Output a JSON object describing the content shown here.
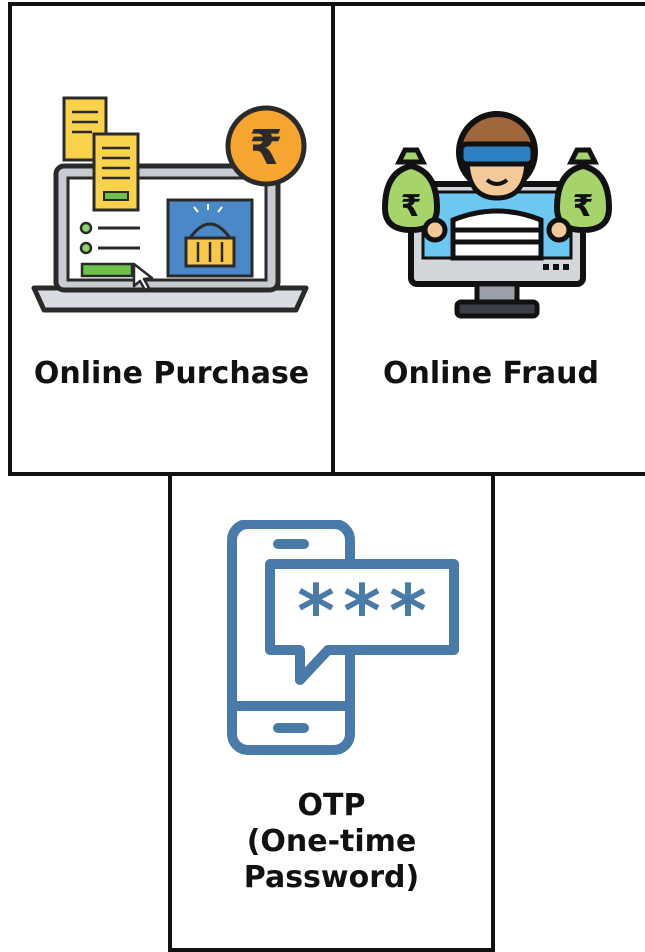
{
  "cards": [
    {
      "label": "Online Purchase",
      "icon": "laptop-shopping-rupee-icon"
    },
    {
      "label": "Online Fraud",
      "icon": "thief-money-bags-monitor-icon"
    },
    {
      "label_lines": [
        "OTP",
        "(One-time",
        "Password)"
      ],
      "icon": "phone-otp-password-icon"
    }
  ],
  "colors": {
    "border": "#111111",
    "otp_blue": "#4a7aa8",
    "rupee_orange": "#f7a531",
    "money_green": "#a7d36b",
    "screen_blue": "#6cc8f0"
  }
}
